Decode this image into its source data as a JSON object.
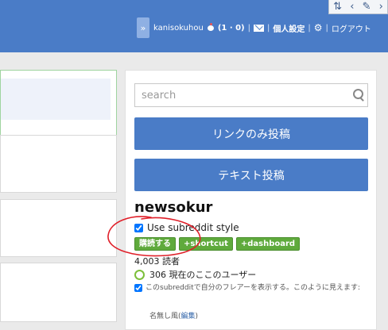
{
  "header": {
    "username": "kanisokuhou",
    "karma": "(1 · 0)",
    "preferences_label": "個人設定",
    "logout_label": "ログアウト",
    "expand_glyph": "»",
    "accent_color": "#4a7cc7"
  },
  "toolbox": {
    "icons": [
      "updown-arrows-icon",
      "chevron-left-icon",
      "pencil-icon",
      "chevron-right-icon"
    ]
  },
  "sidebar": {
    "search_placeholder": "search",
    "submit_link_label": "リンクのみ投稿",
    "submit_text_label": "テキスト投稿",
    "subreddit_name": "newsokur",
    "use_style_label": "Use subreddit style",
    "use_style_checked": true,
    "subscribe_label": "購読する",
    "shortcut_label": "+shortcut",
    "dashboard_label": "+dashboard",
    "readers_text": "4,003 読者",
    "online_text": "306 現在のここのユーザー",
    "flair_text": "このsubredditで自分のフレアーを表示する。このように見えます:",
    "flair_checked": true,
    "flair_name": "名無し風",
    "flair_edit_open": "(",
    "flair_edit_label": "編集",
    "flair_edit_close": ")"
  },
  "annotation_color": "#e0202a"
}
